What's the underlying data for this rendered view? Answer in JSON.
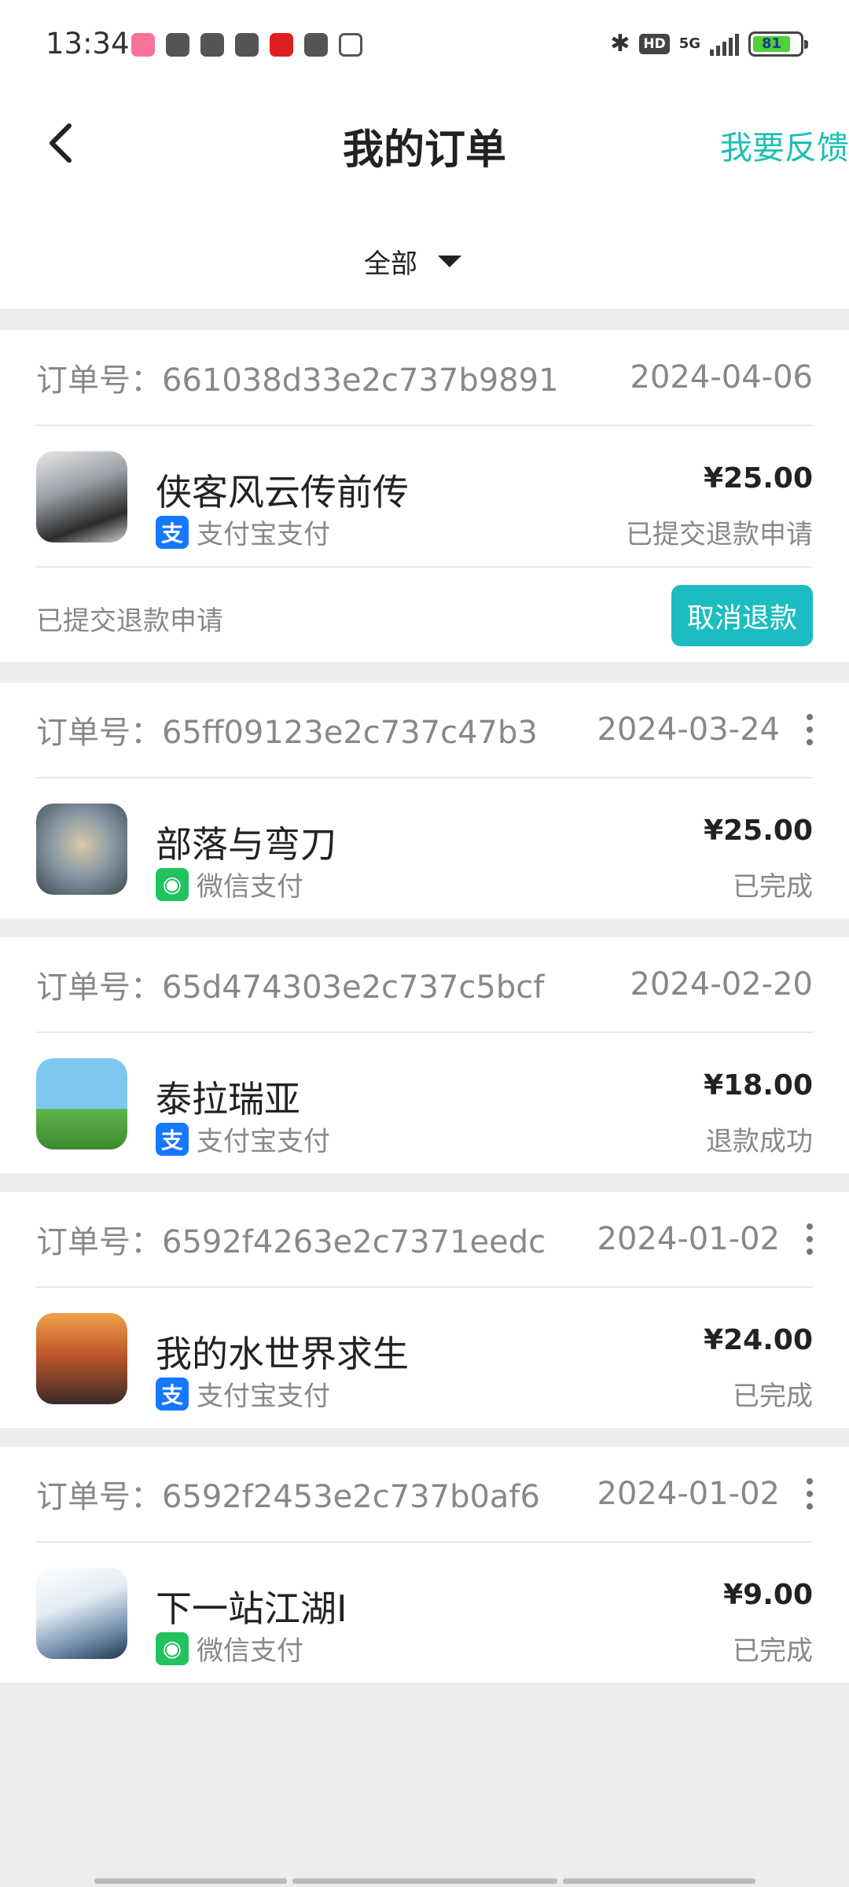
{
  "status_bar": {
    "time": "13:34",
    "network": "5G",
    "hd": "HD",
    "battery": "81",
    "battery_level": 0.81,
    "notification_icons": [
      {
        "name": "bilibili-icon",
        "color": "#fb7299"
      },
      {
        "name": "swirl-app-icon",
        "color": "#555555"
      },
      {
        "name": "tiktok-icon",
        "color": "#555555"
      },
      {
        "name": "video-play-icon",
        "color": "#555555"
      },
      {
        "name": "qidian-icon",
        "color": "#e02020"
      },
      {
        "name": "mail-icon",
        "color": "#555555"
      },
      {
        "name": "handshake-icon",
        "color": "#555555"
      }
    ]
  },
  "header": {
    "title": "我的订单",
    "feedback": "我要反馈",
    "back_icon": "chevron-left-icon"
  },
  "filter": {
    "label": "全部"
  },
  "colors": {
    "accent": "#1cc0b4",
    "button": "#1cbdc0",
    "alipay": "#1677ff",
    "wechat": "#22c35e",
    "background": "#ededed"
  },
  "orders": [
    {
      "order_label": "订单号：",
      "order_no": "661038d33e2c737b9891",
      "date": "2024-04-06",
      "app_name": "侠客风云传前传",
      "pay_icon": "alipay-icon",
      "pay_method": "支付宝支付",
      "price": "¥25.00",
      "status": "已提交退款申请",
      "footer_status": "已提交退款申请",
      "action": "取消退款"
    },
    {
      "order_label": "订单号：",
      "order_no": "65ff09123e2c737c47b3",
      "date": "2024-03-24",
      "app_name": "部落与弯刀",
      "pay_icon": "wechat-pay-icon",
      "pay_method": "微信支付",
      "price": "¥25.00",
      "status": "已完成"
    },
    {
      "order_label": "订单号：",
      "order_no": "65d474303e2c737c5bcf",
      "date": "2024-02-20",
      "app_name": "泰拉瑞亚",
      "pay_icon": "alipay-icon",
      "pay_method": "支付宝支付",
      "price": "¥18.00",
      "status": "退款成功"
    },
    {
      "order_label": "订单号：",
      "order_no": "6592f4263e2c7371eedc",
      "date": "2024-01-02",
      "app_name": "我的水世界求生",
      "pay_icon": "alipay-icon",
      "pay_method": "支付宝支付",
      "price": "¥24.00",
      "status": "已完成"
    },
    {
      "order_label": "订单号：",
      "order_no": "6592f2453e2c737b0af6",
      "date": "2024-01-02",
      "app_name": "下一站江湖Ⅰ",
      "pay_icon": "wechat-pay-icon",
      "pay_method": "微信支付",
      "price": "¥9.00",
      "status": "已完成"
    }
  ]
}
